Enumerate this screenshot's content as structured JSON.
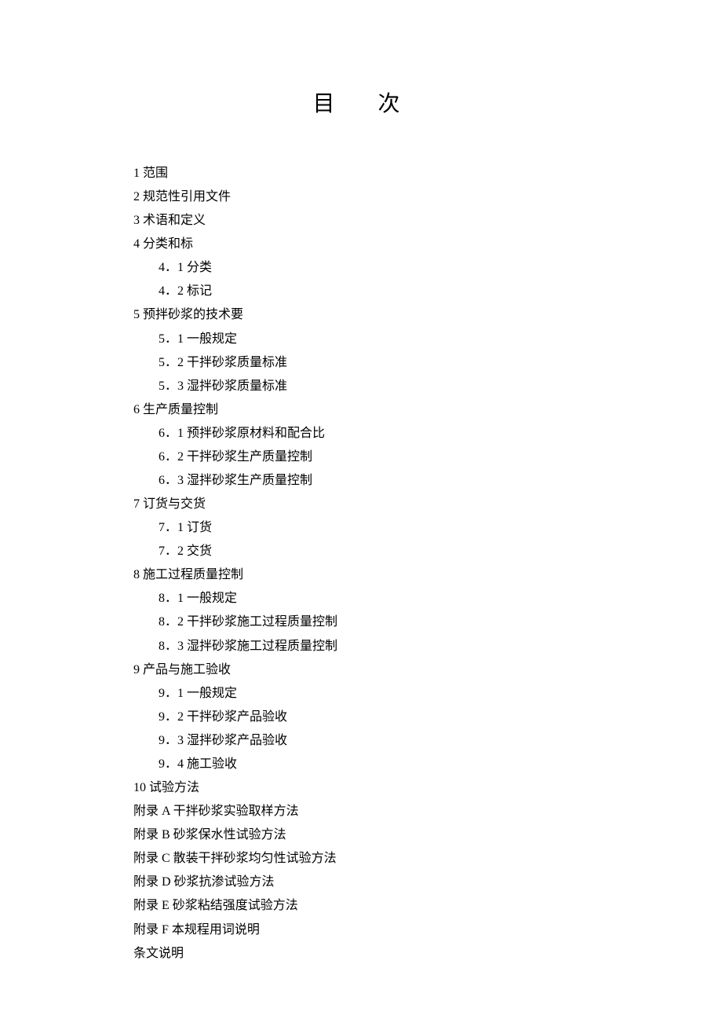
{
  "title": "目 次",
  "toc": [
    {
      "level": 0,
      "text": "1 范围"
    },
    {
      "level": 0,
      "text": "2 规范性引用文件"
    },
    {
      "level": 0,
      "text": "3 术语和定义"
    },
    {
      "level": 0,
      "text": "4 分类和标"
    },
    {
      "level": 1,
      "text": "4．1 分类"
    },
    {
      "level": 1,
      "text": "4．2 标记"
    },
    {
      "level": 0,
      "text": "5 预拌砂浆的技术要"
    },
    {
      "level": 1,
      "text": "5．1 一般规定"
    },
    {
      "level": 1,
      "text": "5．2 干拌砂浆质量标准"
    },
    {
      "level": 1,
      "text": "5．3 湿拌砂浆质量标准"
    },
    {
      "level": 0,
      "text": "6 生产质量控制"
    },
    {
      "level": 1,
      "text": "6．1 预拌砂浆原材料和配合比"
    },
    {
      "level": 1,
      "text": "6．2 干拌砂浆生产质量控制"
    },
    {
      "level": 1,
      "text": "6．3 湿拌砂浆生产质量控制"
    },
    {
      "level": 0,
      "text": "7 订货与交货"
    },
    {
      "level": 1,
      "text": "7．1 订货"
    },
    {
      "level": 1,
      "text": "7．2 交货"
    },
    {
      "level": 0,
      "text": "8 施工过程质量控制"
    },
    {
      "level": 1,
      "text": "8．1 一般规定"
    },
    {
      "level": 1,
      "text": "8．2 干拌砂浆施工过程质量控制"
    },
    {
      "level": 1,
      "text": "8．3 湿拌砂浆施工过程质量控制"
    },
    {
      "level": 0,
      "text": "9 产品与施工验收"
    },
    {
      "level": 1,
      "text": "9．1 一般规定"
    },
    {
      "level": 1,
      "text": "9．2 干拌砂浆产品验收"
    },
    {
      "level": 1,
      "text": "9．3 湿拌砂浆产品验收"
    },
    {
      "level": 1,
      "text": "9．4 施工验收"
    },
    {
      "level": 0,
      "text": "10 试验方法"
    },
    {
      "level": 0,
      "text": "附录 A 干拌砂浆实验取样方法"
    },
    {
      "level": 0,
      "text": "附录 B 砂浆保水性试验方法"
    },
    {
      "level": 0,
      "text": "附录 C 散装干拌砂浆均匀性试验方法"
    },
    {
      "level": 0,
      "text": "附录 D 砂浆抗渗试验方法"
    },
    {
      "level": 0,
      "text": "附录 E 砂浆粘结强度试验方法"
    },
    {
      "level": 0,
      "text": "附录 F 本规程用词说明"
    },
    {
      "level": 0,
      "text": "条文说明"
    }
  ]
}
